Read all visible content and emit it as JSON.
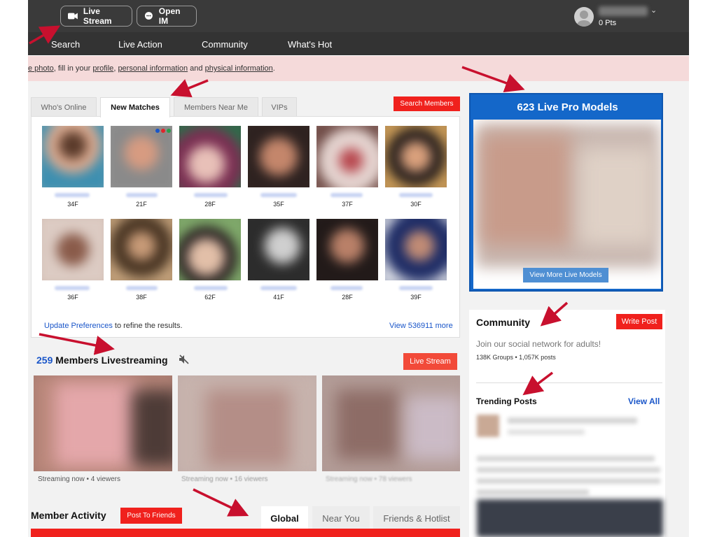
{
  "header": {
    "live_stream_label": "Live Stream",
    "open_im_label": "Open IM",
    "points": "0 Pts",
    "nav": [
      "Search",
      "Live Action",
      "Community",
      "What's Hot"
    ]
  },
  "notice": {
    "prefix_link": "e photo",
    "text1": ", fill in your ",
    "profile_link": "profile",
    "comma": ", ",
    "personal_link": "personal information",
    "and": " and ",
    "physical_link": "physical information",
    "end": "."
  },
  "matches": {
    "tabs": [
      "Who's Online",
      "New Matches",
      "Members Near Me",
      "VIPs"
    ],
    "search_button": "Search Members",
    "row1": [
      "34F",
      "21F",
      "28F",
      "35F",
      "37F",
      "30F"
    ],
    "row2": [
      "36F",
      "38F",
      "62F",
      "41F",
      "28F",
      "39F"
    ],
    "update_link": "Update Preferences",
    "update_text": " to refine the results.",
    "view_more": "View 536911 more"
  },
  "live_models": {
    "title": "623 Live Pro Models",
    "button": "View More Live Models"
  },
  "community": {
    "title": "Community",
    "write_post": "Write Post",
    "subtitle": "Join our social network for adults!",
    "stats": "138K Groups • 1,057K posts",
    "trending": "Trending Posts",
    "view_all": "View All"
  },
  "livestreaming": {
    "count": "259",
    "label": " Members Livestreaming",
    "button": "Live Stream",
    "captions": [
      "Streaming now • 4 viewers",
      "Streaming now • 16 viewers",
      "Streaming now • 78 viewers"
    ]
  },
  "activity": {
    "title": "Member Activity",
    "post_button": "Post To Friends",
    "tabs": [
      "Global",
      "Near You",
      "Friends & Hotlist"
    ]
  },
  "colors": {
    "accent_red": "#f0211d",
    "link_blue": "#1a56c9",
    "model_blue": "#1467c9",
    "arrow_red": "#c8102e"
  }
}
